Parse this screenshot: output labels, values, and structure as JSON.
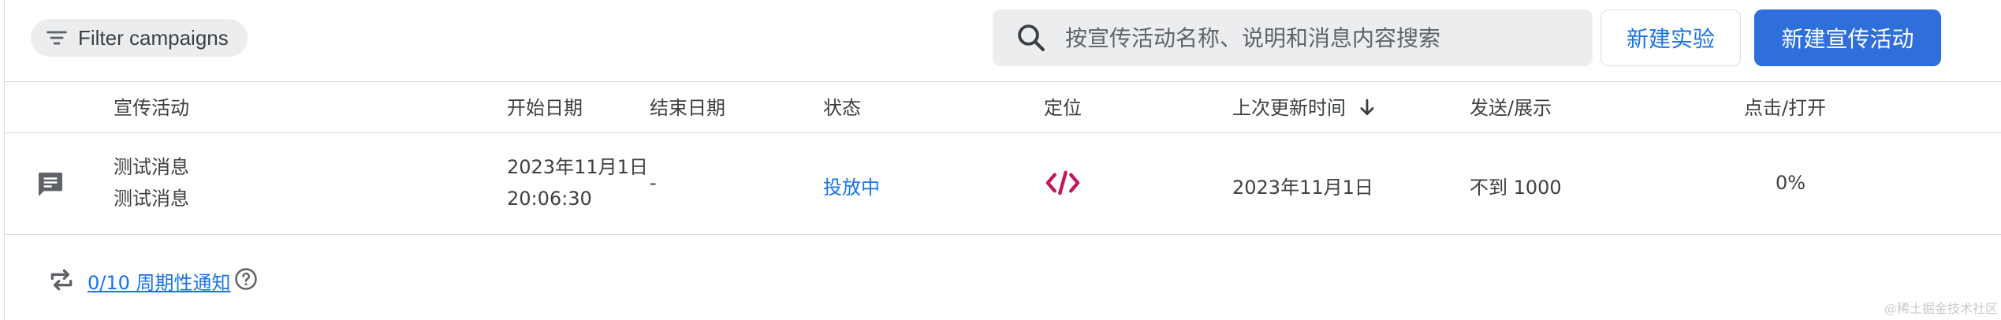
{
  "toolbar": {
    "filter_label": "Filter campaigns",
    "search_placeholder": "按宣传活动名称、说明和消息内容搜索",
    "new_experiment_label": "新建实验",
    "new_campaign_label": "新建宣传活动"
  },
  "table": {
    "columns": {
      "campaign": "宣传活动",
      "start_date": "开始日期",
      "end_date": "结束日期",
      "status": "状态",
      "targeting": "定位",
      "last_updated": "上次更新时间",
      "sends": "发送/展示",
      "clicks": "点击/打开"
    },
    "rows": [
      {
        "icon": "message-icon",
        "name": "测试消息",
        "description": "测试消息",
        "start_date": "2023年11月1日",
        "start_time": "20:06:30",
        "end_date": "-",
        "status": "投放中",
        "targeting_icon": "code-icon",
        "last_updated": "2023年11月1日",
        "sends": "不到 1000",
        "clicks": "0%"
      }
    ]
  },
  "footer": {
    "recurring_link": "0/10 周期性通知"
  },
  "watermark": "@稀土掘金技术社区",
  "colors": {
    "accent": "#1a73e8",
    "primary_button": "#2f6fdc",
    "code_icon": "#c2185b"
  }
}
